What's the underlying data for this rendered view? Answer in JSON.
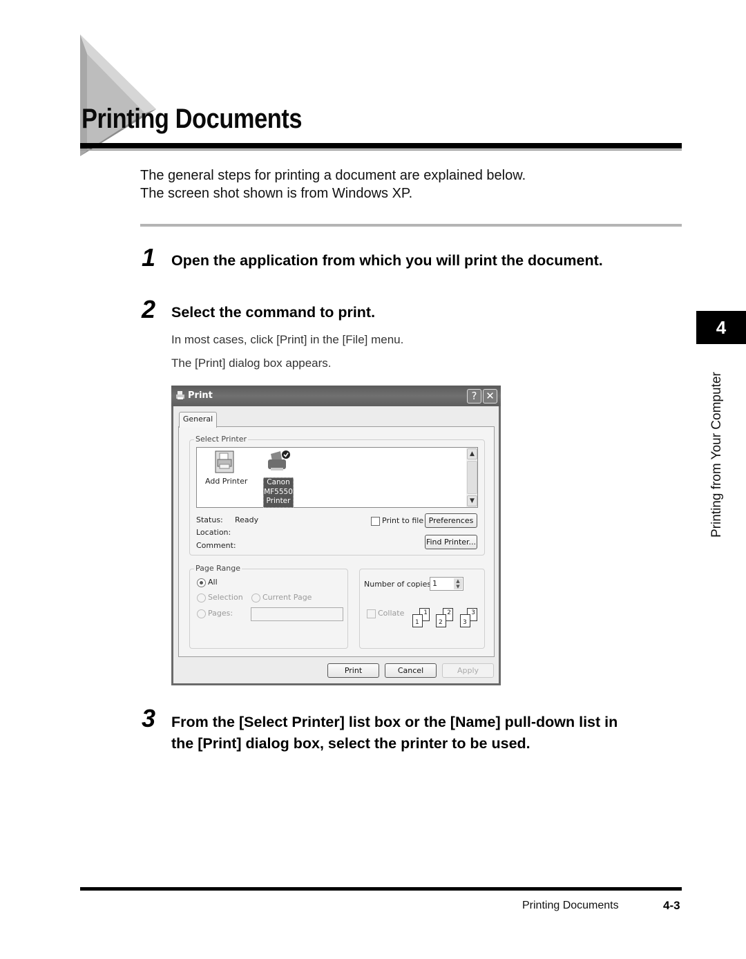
{
  "header": {
    "title": "Printing Documents"
  },
  "intro": {
    "line1": "The general steps for printing a document are explained below.",
    "line2": "The screen shot shown is from Windows XP."
  },
  "steps": [
    {
      "number": "1",
      "text": "Open the application from which you will print the document."
    },
    {
      "number": "2",
      "text": "Select the command to print.",
      "sub": [
        "In most cases, click [Print] in the [File] menu.",
        "The [Print] dialog box appears."
      ]
    },
    {
      "number": "3",
      "text_line1": "From the [Select Printer] list box or the [Name] pull-down list in",
      "text_line2": "the [Print] dialog box, select the printer to be used."
    }
  ],
  "side_tab": {
    "chapter": "4",
    "label": "Printing from Your Computer"
  },
  "footer": {
    "section": "Printing Documents",
    "page": "4-3"
  },
  "dialog": {
    "title": "Print",
    "help_button": "?",
    "close_button": "✕",
    "tab": "General",
    "select_printer": {
      "label": "Select Printer",
      "items": [
        {
          "name": "Add Printer",
          "icon": "add-printer-icon",
          "selected": false
        },
        {
          "name_lines": [
            "Canon",
            "MF5550",
            "Printer"
          ],
          "icon": "printer-icon",
          "selected": true,
          "default": true
        }
      ]
    },
    "status_label": "Status:",
    "status_value": "Ready",
    "location_label": "Location:",
    "location_value": "",
    "comment_label": "Comment:",
    "comment_value": "",
    "print_to_file": {
      "label": "Print to file",
      "checked": false
    },
    "preferences_button": "Preferences",
    "find_printer_button": "Find Printer...",
    "page_range": {
      "label": "Page Range",
      "all": "All",
      "selection": "Selection",
      "current_page": "Current Page",
      "pages": "Pages:",
      "pages_value": "",
      "selected": "All"
    },
    "copies": {
      "label": "Number of copies:",
      "value": "1",
      "collate_label": "Collate",
      "collate_checked": false,
      "collate_pages": [
        "1",
        "1",
        "2",
        "2",
        "3",
        "3"
      ]
    },
    "buttons": {
      "print": "Print",
      "cancel": "Cancel",
      "apply": "Apply"
    }
  }
}
